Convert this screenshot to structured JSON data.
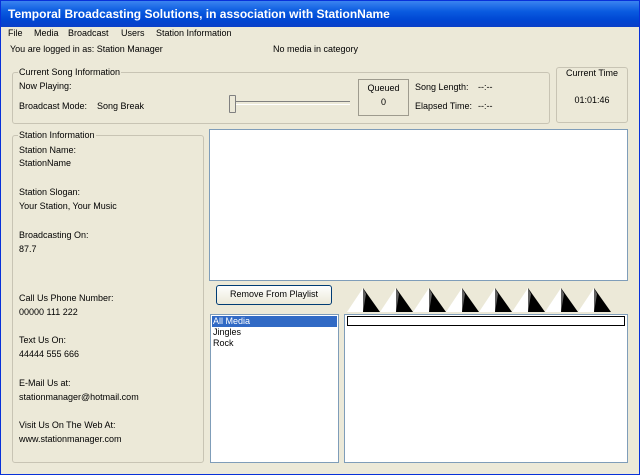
{
  "window": {
    "title": "Temporal Broadcasting Solutions, in association with StationName"
  },
  "menu": {
    "items": [
      "File",
      "Media",
      "Broadcast",
      "Users",
      "Station Information"
    ]
  },
  "status": {
    "logged_in": "You are logged in as: Station Manager",
    "category_message": "No media in category"
  },
  "current_song": {
    "legend": "Current Song Information",
    "now_playing_label": "Now Playing:",
    "now_playing_value": "",
    "broadcast_mode_label": "Broadcast Mode:",
    "broadcast_mode_value": "Song Break",
    "slider_position": 0,
    "queued_label": "Queued",
    "queued_value": "0",
    "song_length_label": "Song Length:",
    "song_length_value": "--:--",
    "elapsed_time_label": "Elapsed Time:",
    "elapsed_time_value": "--:--"
  },
  "current_time": {
    "label": "Current Time",
    "value": "01:01:46"
  },
  "station_info": {
    "legend": "Station Information",
    "name_label": "Station Name:",
    "name_value": "StationName",
    "slogan_label": "Station Slogan:",
    "slogan_value": "Your Station, Your Music",
    "broadcasting_label": "Broadcasting On:",
    "broadcasting_value": "87.7",
    "phone_label": "Call Us Phone Number:",
    "phone_value": "00000 111 222",
    "text_label": "Text Us On:",
    "text_value": "44444 555 666",
    "email_label": "E-Mail Us at:",
    "email_value": "stationmanager@hotmail.com",
    "web_label": "Visit Us On The Web At:",
    "web_value": "www.stationmanager.com"
  },
  "playlist": {
    "remove_button": "Remove From Playlist",
    "items": []
  },
  "categories": {
    "items": [
      "All Media",
      "Jingles",
      "Rock"
    ],
    "selected_index": 0
  },
  "colors": {
    "titlebar": "#0a5be0",
    "selection": "#316ac5",
    "window_bg": "#ece9d8"
  }
}
